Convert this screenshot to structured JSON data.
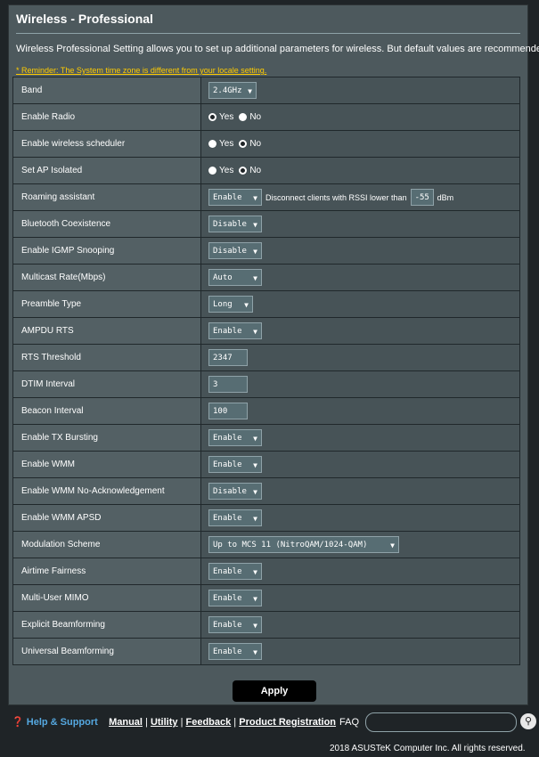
{
  "header": {
    "title": "Wireless - Professional"
  },
  "description": "Wireless Professional Setting allows you to set up additional parameters for wireless. But default values are recommended.",
  "reminder": "* Reminder: The System time zone is different from your locale setting.",
  "rows": [
    {
      "label": "Band",
      "type": "select",
      "value": "2.4GHz",
      "width": 54
    },
    {
      "label": "Enable Radio",
      "type": "radio",
      "yes": "Yes",
      "no": "No",
      "selected": "Yes"
    },
    {
      "label": "Enable wireless scheduler",
      "type": "radio",
      "yes": "Yes",
      "no": "No",
      "selected": "No"
    },
    {
      "label": "Set AP Isolated",
      "type": "radio",
      "yes": "Yes",
      "no": "No",
      "selected": "No"
    },
    {
      "label": "Roaming assistant",
      "type": "roaming",
      "value": "Enable",
      "text": "Disconnect clients with RSSI lower than",
      "rssi": "-55",
      "unit": "dBm"
    },
    {
      "label": "Bluetooth Coexistence",
      "type": "select",
      "value": "Disable"
    },
    {
      "label": "Enable IGMP Snooping",
      "type": "select",
      "value": "Disable"
    },
    {
      "label": "Multicast Rate(Mbps)",
      "type": "select",
      "value": "Auto"
    },
    {
      "label": "Preamble Type",
      "type": "select",
      "value": "Long"
    },
    {
      "label": "AMPDU RTS",
      "type": "select",
      "value": "Enable"
    },
    {
      "label": "RTS Threshold",
      "type": "text",
      "value": "2347"
    },
    {
      "label": "DTIM Interval",
      "type": "text",
      "value": "3"
    },
    {
      "label": "Beacon Interval",
      "type": "text",
      "value": "100"
    },
    {
      "label": "Enable TX Bursting",
      "type": "select",
      "value": "Enable"
    },
    {
      "label": "Enable WMM",
      "type": "select",
      "value": "Enable"
    },
    {
      "label": "Enable WMM No-Acknowledgement",
      "type": "select",
      "value": "Disable"
    },
    {
      "label": "Enable WMM APSD",
      "type": "select",
      "value": "Enable"
    },
    {
      "label": "Modulation Scheme",
      "type": "select",
      "value": "Up to MCS 11 (NitroQAM/1024-QAM)"
    },
    {
      "label": "Airtime Fairness",
      "type": "select",
      "value": "Enable"
    },
    {
      "label": "Multi-User MIMO",
      "type": "select",
      "value": "Enable"
    },
    {
      "label": "Explicit Beamforming",
      "type": "select",
      "value": "Enable"
    },
    {
      "label": "Universal Beamforming",
      "type": "select",
      "value": "Enable"
    }
  ],
  "apply_label": "Apply",
  "footer": {
    "help": "Help & Support",
    "links": [
      "Manual",
      "Utility",
      "Feedback",
      "Product Registration"
    ],
    "faq": "FAQ",
    "copyright": "2018 ASUSTeK Computer Inc. All rights reserved."
  },
  "colors": {
    "reminder": "#ffcc00",
    "panel": "#4d595d",
    "page_bg": "#1f2427"
  }
}
